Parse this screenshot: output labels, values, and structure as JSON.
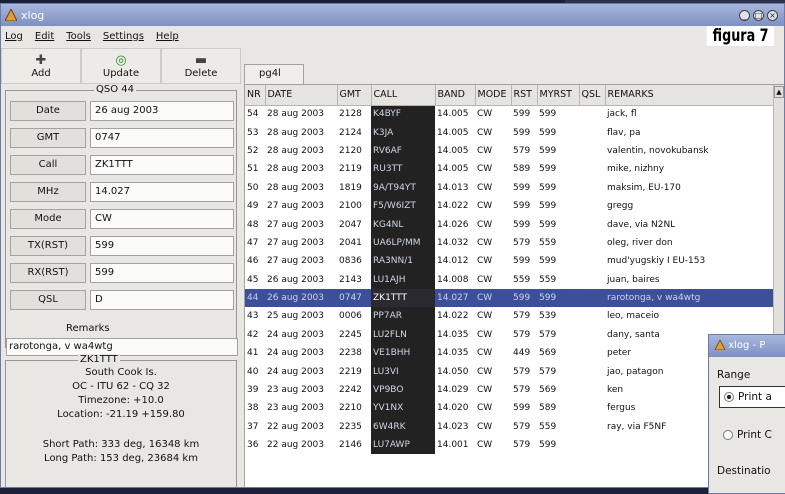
{
  "window": {
    "title": "xlog"
  },
  "figure_label": "figura 7",
  "menu": [
    "Log",
    "Edit",
    "Tools",
    "Settings",
    "Help"
  ],
  "toolbar": {
    "add": "Add",
    "update": "Update",
    "delete": "Delete"
  },
  "qso": {
    "title": "QSO 44",
    "fields": [
      {
        "label": "Date",
        "value": "26 aug 2003"
      },
      {
        "label": "GMT",
        "value": "0747"
      },
      {
        "label": "Call",
        "value": "ZK1TTT"
      },
      {
        "label": "MHz",
        "value": "14.027"
      },
      {
        "label": "Mode",
        "value": "CW"
      },
      {
        "label": "TX(RST)",
        "value": "599"
      },
      {
        "label": "RX(RST)",
        "value": "599"
      },
      {
        "label": "QSL",
        "value": "D"
      }
    ],
    "remarks_label": "Remarks",
    "remarks_value": "rarotonga, v wa4wtg"
  },
  "info": {
    "title": "ZK1TTT",
    "lines": [
      "South Cook Is.",
      "OC - ITU 62 - CQ 32",
      "Timezone: +10.0",
      "Location: -21.19 +159.80",
      "",
      "Short Path: 333 deg, 16348 km",
      "Long Path: 153 deg, 23684 km"
    ]
  },
  "log": {
    "tab": "pg4l",
    "columns": [
      "NR",
      "DATE",
      "GMT",
      "CALL",
      "BAND",
      "MODE",
      "RST",
      "MYRST",
      "QSL",
      "REMARKS"
    ],
    "selected_nr": "44",
    "rows": [
      [
        "54",
        "28 aug 2003",
        "2128",
        "K4BYF",
        "14.005",
        "CW",
        "599",
        "599",
        "",
        "jack, fl"
      ],
      [
        "53",
        "28 aug 2003",
        "2124",
        "K3JA",
        "14.005",
        "CW",
        "599",
        "599",
        "",
        "flav, pa"
      ],
      [
        "52",
        "28 aug 2003",
        "2120",
        "RV6AF",
        "14.005",
        "CW",
        "579",
        "599",
        "",
        "valentin, novokubansk"
      ],
      [
        "51",
        "28 aug 2003",
        "2119",
        "RU3TT",
        "14.005",
        "CW",
        "589",
        "599",
        "",
        "mike, nizhny"
      ],
      [
        "50",
        "28 aug 2003",
        "1819",
        "9A/T94YT",
        "14.013",
        "CW",
        "599",
        "599",
        "",
        "maksim, EU-170"
      ],
      [
        "49",
        "27 aug 2003",
        "2100",
        "F5/W6IZT",
        "14.022",
        "CW",
        "599",
        "599",
        "",
        "gregg"
      ],
      [
        "48",
        "27 aug 2003",
        "2047",
        "KG4NL",
        "14.026",
        "CW",
        "599",
        "599",
        "",
        "dave, via N2NL"
      ],
      [
        "47",
        "27 aug 2003",
        "2041",
        "UA6LP/MM",
        "14.032",
        "CW",
        "579",
        "559",
        "",
        "oleg, river don"
      ],
      [
        "46",
        "27 aug 2003",
        "0836",
        "RA3NN/1",
        "14.012",
        "CW",
        "599",
        "599",
        "",
        "mud'yugskiy I EU-153"
      ],
      [
        "45",
        "26 aug 2003",
        "2143",
        "LU1AJH",
        "14.008",
        "CW",
        "559",
        "559",
        "",
        "juan, baires"
      ],
      [
        "44",
        "26 aug 2003",
        "0747",
        "ZK1TTT",
        "14.027",
        "CW",
        "599",
        "599",
        "",
        "rarotonga, v wa4wtg"
      ],
      [
        "43",
        "25 aug 2003",
        "0006",
        "PP7AR",
        "14.022",
        "CW",
        "579",
        "539",
        "",
        "leo, maceio"
      ],
      [
        "42",
        "24 aug 2003",
        "2245",
        "LU2FLN",
        "14.035",
        "CW",
        "579",
        "579",
        "",
        "dany, santa"
      ],
      [
        "41",
        "24 aug 2003",
        "2238",
        "VE1BHH",
        "14.035",
        "CW",
        "449",
        "569",
        "",
        "peter"
      ],
      [
        "40",
        "24 aug 2003",
        "2219",
        "LU3VI",
        "14.050",
        "CW",
        "579",
        "579",
        "",
        "jao, patagon"
      ],
      [
        "39",
        "23 aug 2003",
        "2242",
        "VP9BO",
        "14.029",
        "CW",
        "579",
        "569",
        "",
        "ken"
      ],
      [
        "38",
        "23 aug 2003",
        "2210",
        "YV1NX",
        "14.020",
        "CW",
        "599",
        "589",
        "",
        "fergus"
      ],
      [
        "37",
        "22 aug 2003",
        "2235",
        "6W4RK",
        "14.023",
        "CW",
        "579",
        "559",
        "",
        "ray, via F5NF"
      ],
      [
        "36",
        "22 aug 2003",
        "2146",
        "LU7AWP",
        "14.001",
        "CW",
        "579",
        "599",
        "",
        ""
      ]
    ]
  },
  "dialog": {
    "title": "xlog - P",
    "range_label": "Range",
    "opt1": "Print a",
    "opt2": "Print C",
    "dest_label": "Destinatio"
  }
}
